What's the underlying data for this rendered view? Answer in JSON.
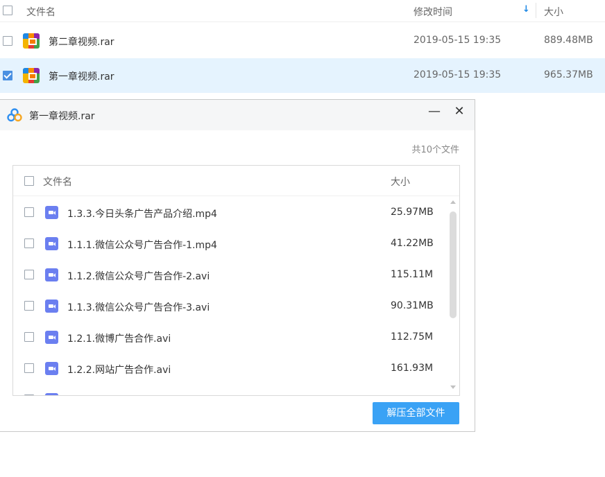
{
  "file_list": {
    "headers": {
      "name": "文件名",
      "modified": "修改时间",
      "size": "大小"
    },
    "rows": [
      {
        "name": "第二章视频.rar",
        "modified": "2019-05-15 19:35",
        "size": "889.48MB",
        "checked": false
      },
      {
        "name": "第一章视频.rar",
        "modified": "2019-05-15 19:35",
        "size": "965.37MB",
        "checked": true
      }
    ]
  },
  "dialog": {
    "title": "第一章视频.rar",
    "minimize_label": "—",
    "close_label": "✕",
    "file_count": "共10个文件",
    "headers": {
      "name": "文件名",
      "size": "大小"
    },
    "files": [
      {
        "name": "1.3.3.今日头条广告产品介绍.mp4",
        "size": "25.97MB"
      },
      {
        "name": "1.1.1.微信公众号广告合作-1.mp4",
        "size": "41.22MB"
      },
      {
        "name": "1.1.2.微信公众号广告合作-2.avi",
        "size": "115.11M"
      },
      {
        "name": "1.1.3.微信公众号广告合作-3.avi",
        "size": "90.31MB"
      },
      {
        "name": "1.2.1.微博广告合作.avi",
        "size": "112.75M"
      },
      {
        "name": "1.2.2.网站广告合作.avi",
        "size": "161.93M"
      }
    ],
    "extract_all_button": "解压全部文件"
  },
  "colors": {
    "accent": "#3aa2f5",
    "selected_row": "#e5f3fe",
    "video_icon": "#6b7ff0"
  }
}
